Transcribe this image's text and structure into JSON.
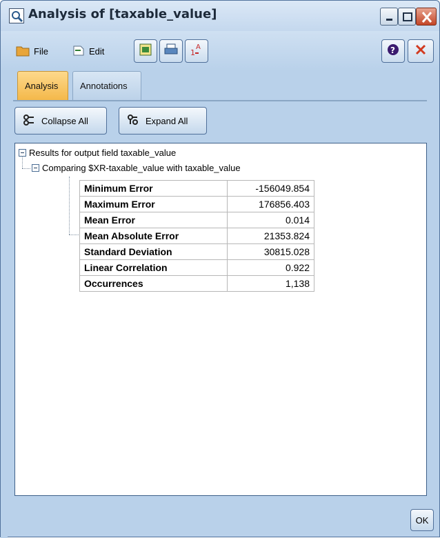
{
  "window": {
    "title": "Analysis of [taxable_value]",
    "accent": "#b9d1ea",
    "close_color": "#c34527"
  },
  "toolbar": {
    "file_label": "File",
    "edit_label": "Edit",
    "icons": [
      "table-export-icon",
      "print-icon",
      "sort-icon",
      "help-icon",
      "close-x-icon"
    ]
  },
  "tabs": [
    {
      "label": "Analysis",
      "active": true
    },
    {
      "label": "Annotations",
      "active": false
    }
  ],
  "actions": {
    "collapse_label": "Collapse All",
    "expand_label": "Expand All"
  },
  "tree": {
    "root_label": "Results for output field taxable_value",
    "child_label": "Comparing $XR-taxable_value with taxable_value"
  },
  "results": [
    {
      "label": "Minimum Error",
      "value": "-156049.854"
    },
    {
      "label": "Maximum Error",
      "value": "176856.403"
    },
    {
      "label": "Mean Error",
      "value": "0.014"
    },
    {
      "label": "Mean Absolute Error",
      "value": "21353.824"
    },
    {
      "label": "Standard Deviation",
      "value": "30815.028"
    },
    {
      "label": "Linear Correlation",
      "value": "0.922"
    },
    {
      "label": "Occurrences",
      "value": "1,138"
    }
  ],
  "footer": {
    "ok_label": "OK"
  }
}
